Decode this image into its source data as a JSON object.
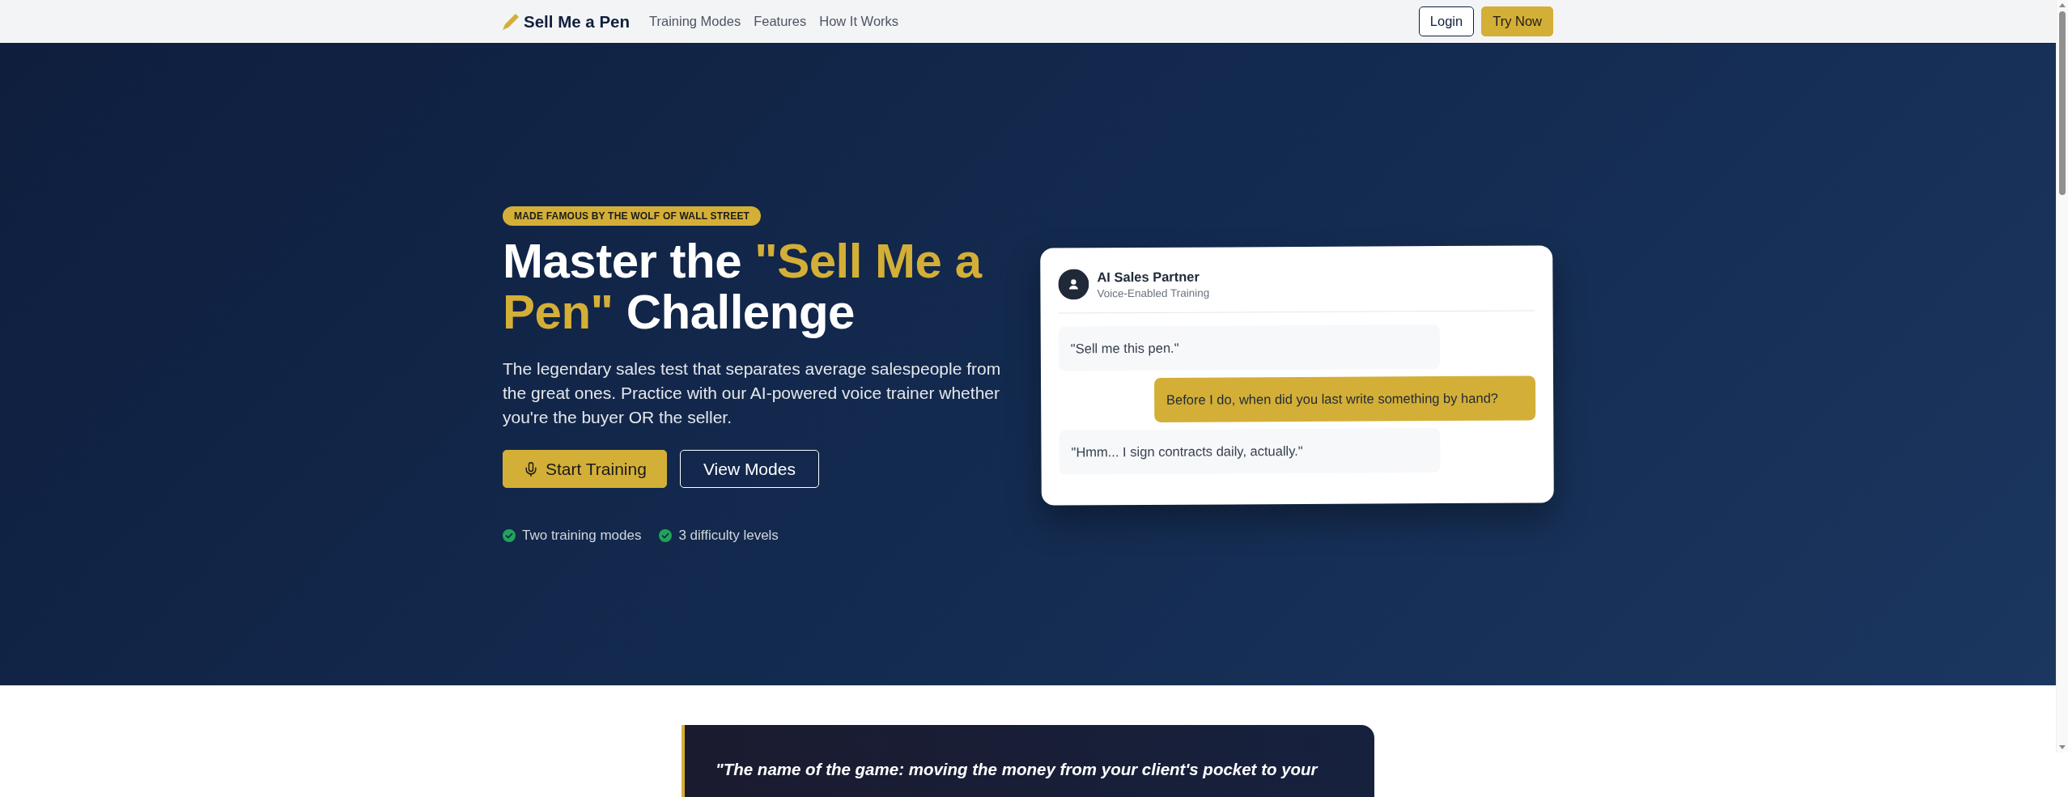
{
  "nav": {
    "logo": "Sell Me a Pen",
    "links": [
      {
        "label": "Training Modes"
      },
      {
        "label": "Features"
      },
      {
        "label": "How It Works"
      }
    ],
    "buttons": [
      {
        "label": "Login",
        "kind": "outline"
      },
      {
        "label": "Try Now",
        "kind": "primary"
      }
    ]
  },
  "hero": {
    "badge": "MADE FAMOUS BY THE WOLF OF WALL STREET",
    "headline": [
      {
        "text": "Master the ",
        "kind": "plain"
      },
      {
        "text": "\"Sell Me a Pen\"",
        "kind": "accent"
      },
      {
        "text": " Challenge",
        "kind": "plain"
      }
    ],
    "description": "The legendary sales test that separates average salespeople from the great ones. Practice with our AI-powered voice trainer whether you're the buyer OR the seller.",
    "buttons": [
      {
        "label": "Start Training",
        "kind": "primary"
      },
      {
        "label": "View Modes",
        "kind": "outline"
      }
    ],
    "features": [
      "Two training modes",
      "3 difficulty levels"
    ]
  },
  "chat": {
    "title": "AI Sales Partner",
    "subtitle": "Voice-Enabled Training",
    "messages": [
      {
        "text": "\"Sell me this pen.\"",
        "kind": "partner"
      },
      {
        "text": "Before I do, when did you last write something by hand?",
        "kind": "user"
      },
      {
        "text": "\"Hmm... I sign contracts daily, actually.\"",
        "kind": "partner"
      }
    ]
  },
  "quote": {
    "text": "\"The name of the game: moving the money from your client's pocket to your"
  }
}
